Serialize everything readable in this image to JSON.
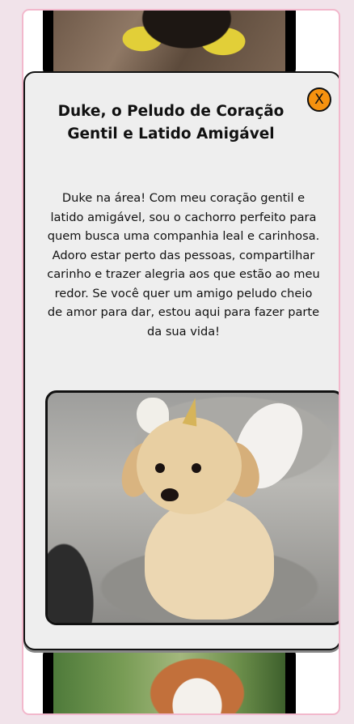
{
  "modal": {
    "title": "Duke, o Peludo de Coração Gentil e Latido Amigável",
    "close_label": "X",
    "description": "Duke na área! Com meu coração gentil e latido amigável, sou o cachorro perfeito para quem busca uma companhia leal e carinhosa. Adoro estar perto das pessoas, compartilhar carinho e trazer alegria aos que estão ao meu redor. Se você quer um amigo peludo cheio de amor para dar, estou aqui para fazer parte da sua vida!"
  },
  "colors": {
    "page_background": "#f1e3ea",
    "frame_border": "#f2b8cc",
    "modal_background": "#eeeeee",
    "close_button": "#f6920f",
    "text": "#111111"
  },
  "icons": {
    "close": "close-icon"
  }
}
